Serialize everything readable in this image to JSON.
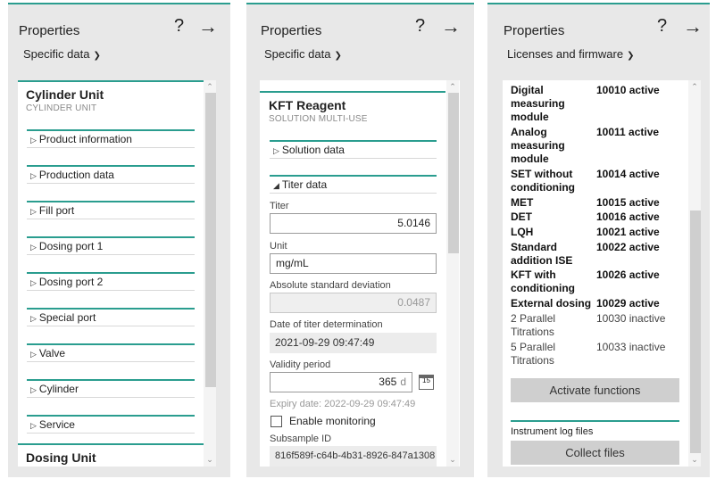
{
  "panel1": {
    "title": "Properties",
    "help": "?",
    "arrow": "→",
    "dropdown": "Specific data",
    "heading": "Cylinder Unit",
    "subheading": "CYLINDER UNIT",
    "sections": [
      "Product information",
      "Production data",
      "Fill port",
      "Dosing port 1",
      "Dosing port 2",
      "Special port",
      "Valve",
      "Cylinder",
      "Service"
    ],
    "footer_heading": "Dosing Unit"
  },
  "panel2": {
    "title": "Properties",
    "help": "?",
    "arrow": "→",
    "dropdown": "Specific data",
    "heading": "KFT Reagent",
    "subheading": "SOLUTION MULTI-USE",
    "section_solution": "Solution data",
    "section_titer": "Titer data",
    "titer_label": "Titer",
    "titer_value": "5.0146",
    "unit_label": "Unit",
    "unit_value": "mg/mL",
    "asd_label": "Absolute standard deviation",
    "asd_value": "0.0487",
    "date_label": "Date of titer determination",
    "date_value": "2021-09-29 09:47:49",
    "validity_label": "Validity period",
    "validity_value": "365",
    "validity_unit": "d",
    "calendar_day": "15",
    "expiry_text": "Expiry date: 2022-09-29 09:47:49",
    "monitoring_label": "Enable monitoring",
    "subsample_label": "Subsample ID",
    "subsample_value": "816f589f-c64b-4b31-8926-847a1308"
  },
  "panel3": {
    "title": "Properties",
    "help": "?",
    "arrow": "→",
    "dropdown": "Licenses and firmware",
    "licenses": [
      {
        "name": "Digital measuring module",
        "code": "10010 active",
        "active": true
      },
      {
        "name": "Analog measuring module",
        "code": "10011 active",
        "active": true
      },
      {
        "name": "SET without conditioning",
        "code": "10014 active",
        "active": true
      },
      {
        "name": "MET",
        "code": "10015 active",
        "active": true
      },
      {
        "name": "DET",
        "code": "10016 active",
        "active": true
      },
      {
        "name": "LQH",
        "code": "10021 active",
        "active": true
      },
      {
        "name": "Standard addition ISE",
        "code": "10022 active",
        "active": true
      },
      {
        "name": "KFT with conditioning",
        "code": "10026 active",
        "active": true
      },
      {
        "name": "External dosing",
        "code": "10029 active",
        "active": true
      },
      {
        "name": "2 Parallel Titrations",
        "code": "10030 inactive",
        "active": false
      },
      {
        "name": "5 Parallel Titrations",
        "code": "10033 inactive",
        "active": false
      }
    ],
    "activate_button": "Activate functions",
    "log_heading": "Instrument log files",
    "collect_button": "Collect files"
  },
  "icons": {
    "chevron_down": "chevron-down-icon",
    "triangle_right": "triangle-right-icon",
    "triangle_down": "triangle-down-icon",
    "calendar": "calendar-icon"
  },
  "colors": {
    "accent": "#2a9d8f",
    "panel_bg": "#e8e8e8"
  }
}
